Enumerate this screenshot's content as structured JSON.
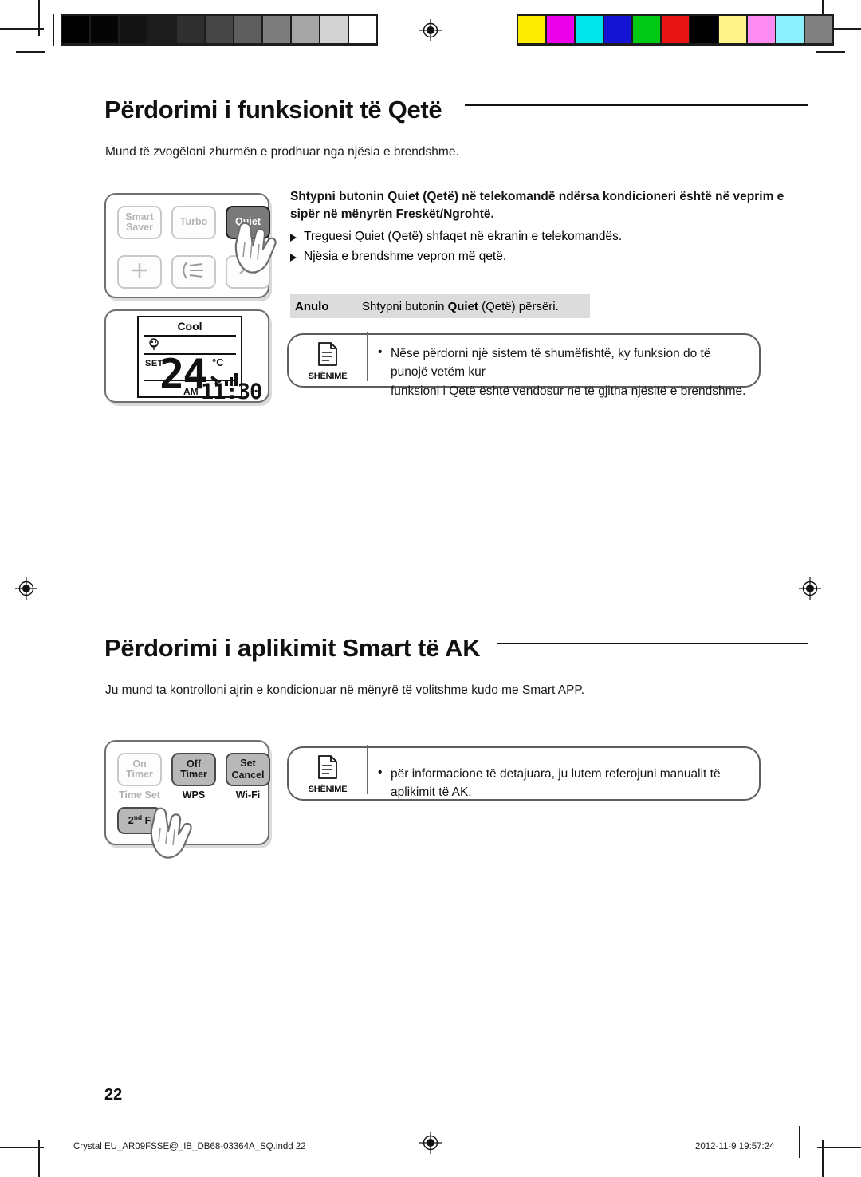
{
  "page": {
    "number": "22",
    "footer_left": "Crystal  EU_AR09FSSE@_IB_DB68-03364A_SQ.indd   22",
    "footer_right": "2012-11-9   19:57:24"
  },
  "print_marks": {
    "grayscale_swatches": [
      "#000000",
      "#050505",
      "#131313",
      "#1d1d1d",
      "#2f2f2f",
      "#464646",
      "#5e5e5e",
      "#7d7d7d",
      "#a5a5a5",
      "#d2d2d2",
      "#ffffff"
    ],
    "color_swatches": [
      "#ffed00",
      "#ec00ec",
      "#00e5ec",
      "#1414d2",
      "#00c814",
      "#e81414",
      "#000000",
      "#fff389",
      "#ff8cf0",
      "#8cf0ff",
      "#808080"
    ],
    "registration_icon": "registration-target-icon"
  },
  "section1": {
    "heading": "Përdorimi i funksionit të Qetë",
    "intro": "Mund të zvogëloni zhurmën e prodhuar nga njësia e brendshme.",
    "lead_line1_a": "Shtypni butonin ",
    "lead_line1_b": "Quiet",
    "lead_line1_c": " (Qetë) në telekomandë ndërsa kondicioneri është në veprim e",
    "lead_line2": "sipër në mënyrën Freskët/Ngrohtë.",
    "bullets": [
      "Treguesi Quiet (Qetë) shfaqet në ekranin e telekomandës.",
      "Njësia e brendshme vepron më qetë."
    ],
    "cancel": {
      "key": "Anulo",
      "value_a": "Shtypni butonin ",
      "value_b": "Quiet",
      "value_c": " (Qetë) përsëri."
    },
    "note": {
      "label": "SHËNIME",
      "icon": "note-document-icon",
      "bullet_marker": "•",
      "line1": "Nëse përdorni një sistem të shumëfishtë, ky funksion do të punojë vetëm kur",
      "line2": "funksioni i Qetë është vendosur në të gjitha njësitë e brendshme."
    },
    "remote": {
      "buttons_row1": [
        "Smart Saver",
        "Turbo",
        "Quiet"
      ],
      "button_smart_line1": "Smart",
      "button_smart_line2": "Saver",
      "button_turbo": "Turbo",
      "button_quiet": "Quiet",
      "buttons_row2_icons": [
        "plus-icon",
        "airflow-swing-icon",
        "chevron-up-icon"
      ],
      "hand": "pointing-hand-icon"
    },
    "lcd": {
      "mode": "Cool",
      "quiet_indicator": "quiet-indicator-icon",
      "set_label": "SET",
      "temperature": "24",
      "unit": "°C",
      "fan_icon": "fan-icon",
      "fan_bars": 3,
      "ampm": "AM",
      "time": "11:30"
    }
  },
  "section2": {
    "heading": "Përdorimi i aplikimit Smart të AK",
    "intro": "Ju mund ta kontrolloni ajrin e kondicionuar në mënyrë të volitshme kudo me Smart APP.",
    "note": {
      "label": "SHËNIME",
      "icon": "note-document-icon",
      "bullet_marker": "•",
      "line1": "për informacione të detajuara, ju lutem referojuni manualit të aplikimit të AK."
    },
    "remote": {
      "button_on_line1": "On",
      "button_on_line2": "Timer",
      "button_off_line1": "Off",
      "button_off_line2": "Timer",
      "button_set_line1": "Set",
      "button_set_line2": "Cancel",
      "caption_time_set": "Time Set",
      "caption_wps": "WPS",
      "caption_wifi": "Wi-Fi",
      "button_2ndf_a": "2",
      "button_2ndf_sup": "nd",
      "button_2ndf_b": " F",
      "hand": "pointing-hand-icon"
    }
  }
}
